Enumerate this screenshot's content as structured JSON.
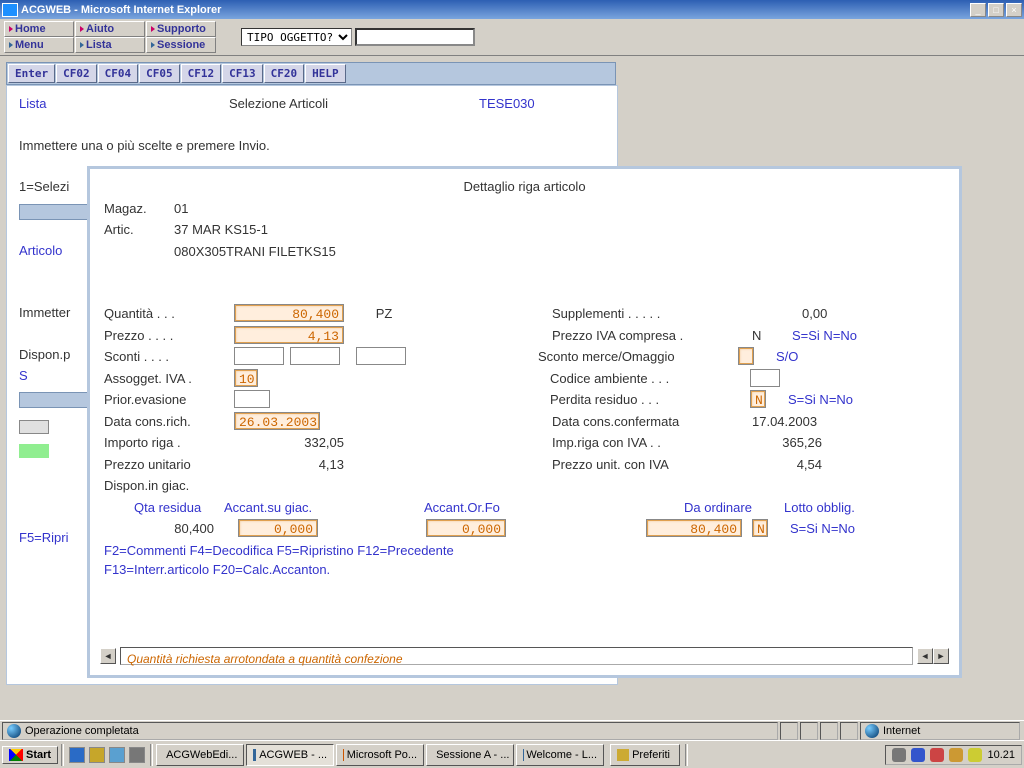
{
  "window": {
    "title": "ACGWEB - Microsoft Internet Explorer",
    "min": "_",
    "max": "□",
    "close": "×"
  },
  "menubar": {
    "r0": [
      "Home",
      "Aiuto",
      "Supporto"
    ],
    "r1": [
      "Menu",
      "Lista",
      "Sessione"
    ]
  },
  "query": {
    "label": "TIPO OGGETTO?",
    "value": ""
  },
  "fkeys": [
    "Enter",
    "CF02",
    "CF04",
    "CF05",
    "CF12",
    "CF13",
    "CF20",
    "HELP"
  ],
  "screen": {
    "line1_left": "Lista",
    "line1_center": "Selezione Articoli",
    "line1_right": "TESE030",
    "line2": "Immettere una o più scelte e premere Invio.",
    "line3": "1=Selezi",
    "left1": "Articolo",
    "left2": "Immetter",
    "left3": "Dispon.p",
    "left4": "S",
    "left5": "F5=Ripri"
  },
  "detail": {
    "title": "Dettaglio riga articolo",
    "magaz_l": "Magaz.",
    "magaz_v": "01",
    "artic_l": "Artic.",
    "artic_v": "37 MAR KS15-1",
    "artic_desc": "080X305TRANI FILETKS15",
    "qta_l": "Quantità . . .",
    "qta_v": "80,400",
    "qta_um": "PZ",
    "suppl_l": "Supplementi . . . . .",
    "suppl_v": "0,00",
    "prezzo_l": "Prezzo  . . . .",
    "prezzo_v": "4,13",
    "iva_comp_l": "Prezzo IVA compresa .",
    "iva_comp_v": "N",
    "iva_comp_hint": "S=Si  N=No",
    "sconti_l": "Sconti  . . . .",
    "sc_merce_l": "Sconto merce/Omaggio",
    "sc_merce_hint": "S/O",
    "assogg_l": "Assogget. IVA .",
    "assogg_v": "10",
    "cod_amb_l": "Codice ambiente . . .",
    "prior_l": "Prior.evasione",
    "perd_l": "Perdita residuo . . .",
    "perd_v": "N",
    "perd_hint": "S=Si  N=No",
    "data_rich_l": "Data cons.rich.",
    "data_rich_v": "26.03.2003",
    "data_conf_l": "Data cons.confermata",
    "data_conf_v": "17.04.2003",
    "imp_riga_l": "Importo riga  .",
    "imp_riga_v": "332,05",
    "imp_riga_iva_l": "Imp.riga con IVA  . .",
    "imp_riga_iva_v": "365,26",
    "pu_l": "Prezzo unitario",
    "pu_v": "4,13",
    "pu_iva_l": "Prezzo unit. con  IVA",
    "pu_iva_v": "4,54",
    "disp_l": "Dispon.in giac.",
    "col1": "Qta residua",
    "col2": "Accant.su giac.",
    "col3": "Accant.Or.Fo",
    "col4": "Da ordinare",
    "col5": "Lotto obblig.",
    "v1": "80,400",
    "v2": "0,000",
    "v3": "0,000",
    "v4": "80,400",
    "v5": "N",
    "v5_hint": "S=Si  N=No",
    "fhints1": "F2=Commenti  F4=Decodifica  F5=Ripristino  F12=Precedente",
    "fhints2": "F13=Interr.articolo  F20=Calc.Accanton.",
    "statusmsg": "Quantità richiesta arrotondata a quantità confezione"
  },
  "statusbar": {
    "left": "Operazione completata",
    "right": "Internet"
  },
  "taskbar": {
    "start": "Start",
    "tasks": [
      "ACGWebEdi...",
      "ACGWEB - ...",
      "Microsoft Po...",
      "Sessione A - ...",
      "Welcome - L..."
    ],
    "prefer": "Preferiti",
    "clock": "10.21"
  }
}
